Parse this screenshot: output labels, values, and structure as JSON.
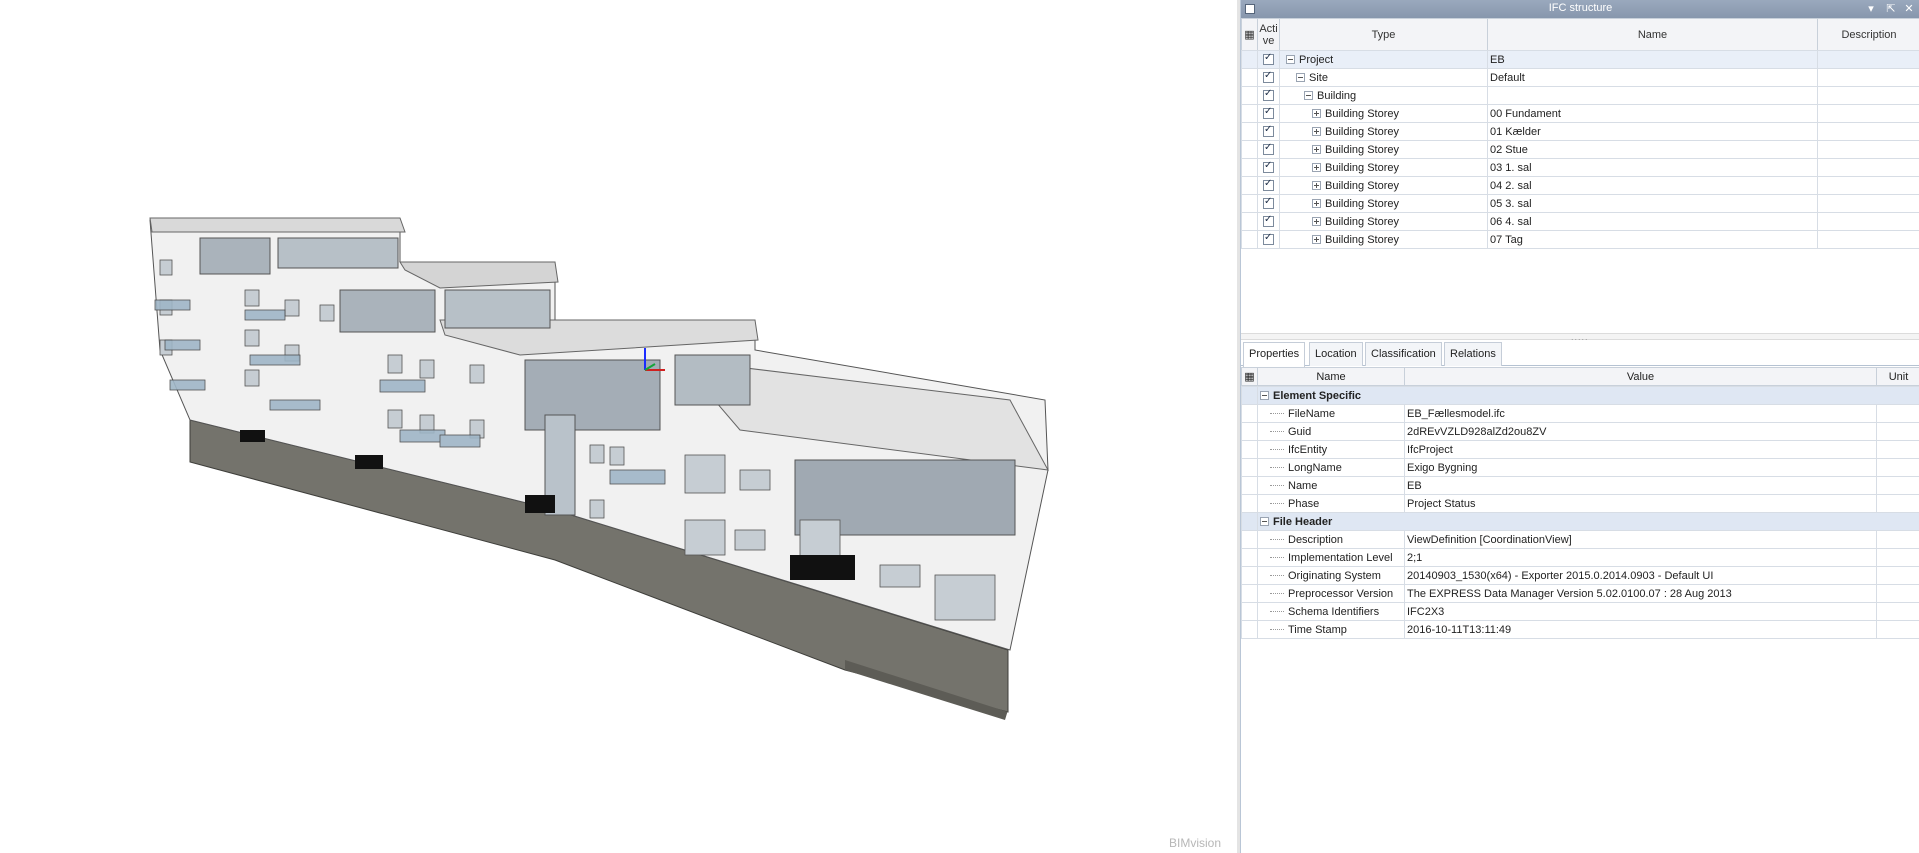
{
  "app": {
    "watermark": "BIMvision"
  },
  "ifc_panel": {
    "title": "IFC structure",
    "columns": {
      "active": "Acti\nve",
      "type": "Type",
      "name": "Name",
      "description": "Description"
    },
    "rows": [
      {
        "type": "Project",
        "name": "EB",
        "level": 0,
        "expander": "minus"
      },
      {
        "type": "Site",
        "name": "Default",
        "level": 1,
        "expander": "minus"
      },
      {
        "type": "Building",
        "name": "",
        "level": 2,
        "expander": "minus"
      },
      {
        "type": "Building Storey",
        "name": "00 Fundament",
        "level": 3,
        "expander": "plus"
      },
      {
        "type": "Building Storey",
        "name": "01 Kælder",
        "level": 3,
        "expander": "plus"
      },
      {
        "type": "Building Storey",
        "name": "02 Stue",
        "level": 3,
        "expander": "plus"
      },
      {
        "type": "Building Storey",
        "name": "03 1. sal",
        "level": 3,
        "expander": "plus"
      },
      {
        "type": "Building Storey",
        "name": "04 2. sal",
        "level": 3,
        "expander": "plus"
      },
      {
        "type": "Building Storey",
        "name": "05 3. sal",
        "level": 3,
        "expander": "plus"
      },
      {
        "type": "Building Storey",
        "name": "06 4. sal",
        "level": 3,
        "expander": "plus"
      },
      {
        "type": "Building Storey",
        "name": "07 Tag",
        "level": 3,
        "expander": "plus"
      }
    ]
  },
  "tabs": [
    "Properties",
    "Location",
    "Classification",
    "Relations"
  ],
  "properties": {
    "columns": {
      "name": "Name",
      "value": "Value",
      "unit": "Unit"
    },
    "groups": [
      {
        "title": "Element Specific",
        "items": [
          {
            "name": "FileName",
            "value": "EB_Fællesmodel.ifc"
          },
          {
            "name": "Guid",
            "value": "2dREvVZLD928alZd2ou8ZV"
          },
          {
            "name": "IfcEntity",
            "value": "IfcProject"
          },
          {
            "name": "LongName",
            "value": "Exigo Bygning"
          },
          {
            "name": "Name",
            "value": "EB"
          },
          {
            "name": "Phase",
            "value": "Project Status"
          }
        ]
      },
      {
        "title": "File Header",
        "items": [
          {
            "name": "Description",
            "value": "ViewDefinition [CoordinationView]"
          },
          {
            "name": "Implementation Level",
            "value": "2;1"
          },
          {
            "name": "Originating System",
            "value": "20140903_1530(x64) - Exporter 2015.0.2014.0903 - Default UI"
          },
          {
            "name": "Preprocessor Version",
            "value": "The EXPRESS Data Manager Version 5.02.0100.07 : 28 Aug 2013"
          },
          {
            "name": "Schema Identifiers",
            "value": "IFC2X3"
          },
          {
            "name": "Time Stamp",
            "value": "2016-10-11T13:11:49"
          }
        ]
      }
    ]
  }
}
